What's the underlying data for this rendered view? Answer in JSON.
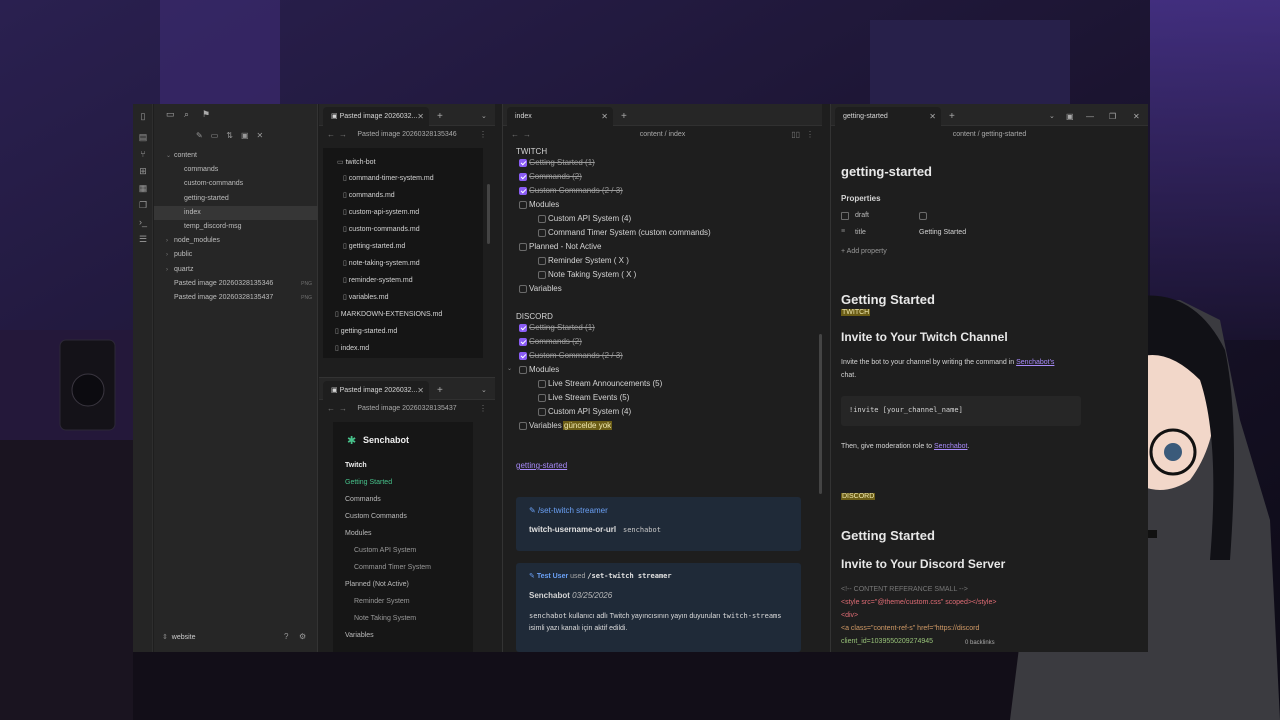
{
  "left_tab": {
    "title": "Pasted image 2026032...",
    "header": "Pasted image 20260328135346"
  },
  "left_tab2": {
    "title": "Pasted image 2026032...",
    "header": "Pasted image 20260328135437"
  },
  "sidebar": {
    "items": [
      {
        "label": "content",
        "chev": "⌄"
      },
      {
        "label": "commands"
      },
      {
        "label": "custom-commands"
      },
      {
        "label": "getting-started"
      },
      {
        "label": "index"
      },
      {
        "label": "temp_discord-msg"
      },
      {
        "label": "node_modules",
        "chev": "›"
      },
      {
        "label": "public",
        "chev": "›"
      },
      {
        "label": "quartz",
        "chev": "›"
      },
      {
        "label": "Pasted image 20260328135346",
        "badge": "PNG"
      },
      {
        "label": "Pasted image 20260328135437",
        "badge": "PNG"
      }
    ],
    "vault": "website"
  },
  "embedded_tree": {
    "folder": "twitch-bot",
    "files": [
      "command-timer-system.md",
      "commands.md",
      "custom-api-system.md",
      "custom-commands.md",
      "getting-started.md",
      "note-taking-system.md",
      "reminder-system.md",
      "variables.md"
    ],
    "root_files": [
      "MARKDOWN-EXTENSIONS.md",
      "getting-started.md",
      "index.md"
    ]
  },
  "site_nav": {
    "brand": "Senchabot",
    "section": "Twitch",
    "items": [
      "Getting Started",
      "Commands",
      "Custom Commands",
      "Modules",
      "Custom API System",
      "Command Timer System",
      "Planned (Not Active)",
      "Reminder System",
      "Note Taking System",
      "Variables"
    ]
  },
  "index": {
    "tab": "index",
    "breadcrumb": "content  /  index",
    "twitch_heading": "TWITCH",
    "twitch": [
      "Getting Started (1)",
      "Commands (2)",
      "Custom Commands (2 / 3)",
      "Modules",
      "Custom API System (4)",
      "Command Timer System (custom commands)",
      "Planned - Not Active",
      "Reminder System ( X )",
      "Note Taking System ( X )",
      "Variables"
    ],
    "discord_heading": "DISCORD",
    "discord": [
      "Getting Started (1)",
      "Commands (2)",
      "Custom Commands (2 / 3)",
      "Modules",
      "Live Stream Announcements (5)",
      "Live Stream Events (5)",
      "Custom API System (4)",
      "Variables"
    ],
    "variables_hl": "güncelde yok",
    "link": "getting-started",
    "callout1_title": "/set-twitch streamer",
    "callout1_param": "twitch-username-or-url",
    "callout1_value": "senchabot",
    "callout2_user": "Test User",
    "callout2_used": "used",
    "callout2_cmd": "/set-twitch streamer",
    "callout2_bot": "Senchabot",
    "callout2_date": "03/25/2026",
    "callout2_code1": "senchabot",
    "callout2_text1": "kullanıcı adlı Twitch yayıncısının yayın duyuruları",
    "callout2_code2": "twitch-streams",
    "callout2_text2": "isimli yazı kanalı için aktif edildi."
  },
  "gs": {
    "tab": "getting-started",
    "breadcrumb": "content  /  getting-started",
    "title": "getting-started",
    "properties": "Properties",
    "prop_draft": "draft",
    "prop_title": "title",
    "prop_title_value": "Getting Started",
    "add_property": "Add property",
    "h1": "Getting Started",
    "twitch_tag": "TWITCH",
    "h2_twitch": "Invite to Your Twitch Channel",
    "p1a": "Invite the bot to your channel by writing the command in",
    "p1link": "Senchabot's",
    "p1b": "chat.",
    "code": "!invite [your_channel_name]",
    "p2a": "Then, give moderation role to",
    "p2link": "Senchabot",
    "discord_tag": "DISCORD",
    "h1b": "Getting Started",
    "h2_discord": "Invite to Your Discord Server",
    "c1": "<!-- CONTENT REFERANCE SMALL -->",
    "c2": "<style src=\"@theme/custom.css\" scoped></style>",
    "c3": "<div>",
    "c4": "<a class=\"content-ref-s\" href=\"https://discord",
    "c5": "client_id=1039550209274945",
    "backlinks": "0 backlinks"
  },
  "colors": {
    "accent": "#8a5cf5",
    "bg": "#1e1e1e",
    "sidebar": "#262626",
    "highlight": "#6b5d16",
    "link": "#a88bfa",
    "green": "#47c28b"
  }
}
